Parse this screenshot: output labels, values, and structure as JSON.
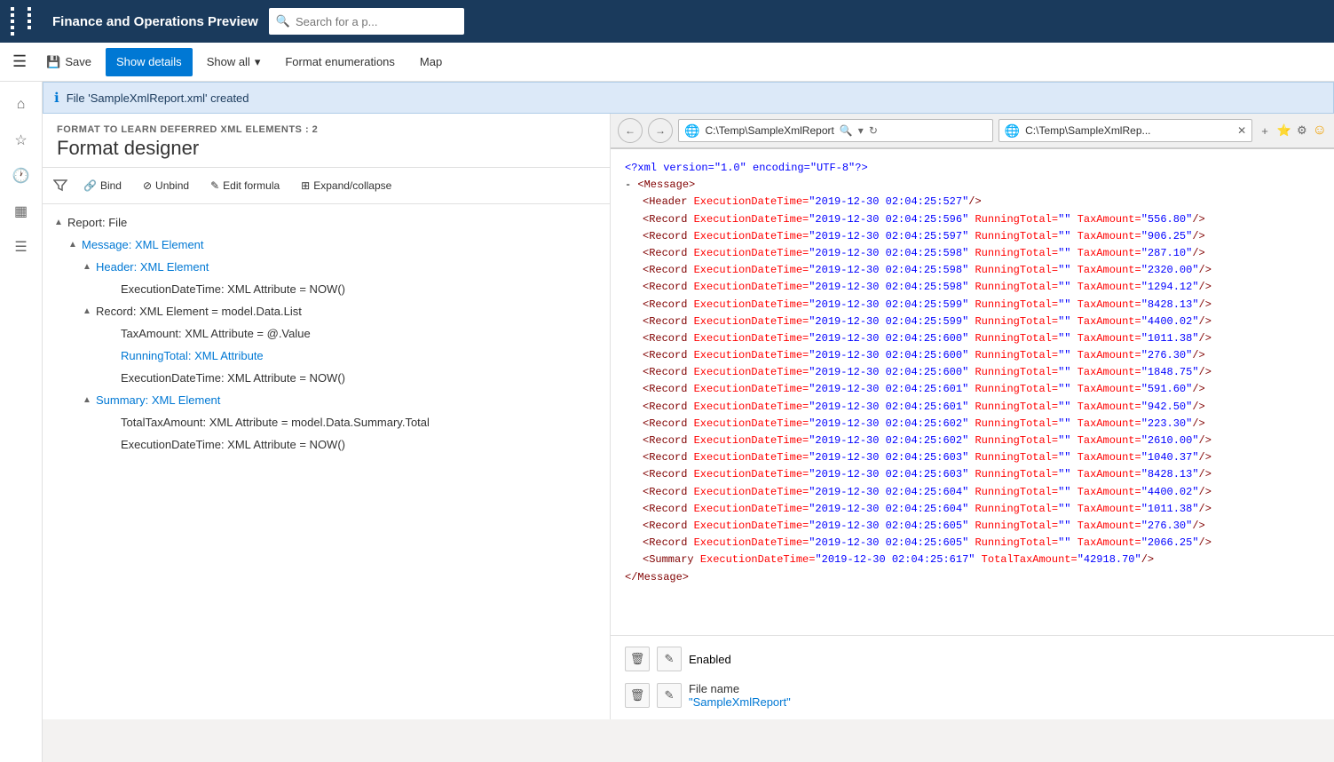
{
  "app": {
    "title": "Finance and Operations Preview",
    "search_placeholder": "Search for a p..."
  },
  "action_bar": {
    "save_label": "Save",
    "show_details_label": "Show details",
    "show_all_label": "Show all",
    "format_enumerations_label": "Format enumerations",
    "map_label": "Map"
  },
  "notification": {
    "text": "File 'SampleXmlReport.xml' created"
  },
  "panel": {
    "subtitle": "FORMAT TO LEARN DEFERRED XML ELEMENTS : 2",
    "title": "Format designer",
    "bind_label": "Bind",
    "unbind_label": "Unbind",
    "edit_formula_label": "Edit formula",
    "expand_collapse_label": "Expand/collapse"
  },
  "tree": {
    "items": [
      {
        "indent": 0,
        "arrow": "▲",
        "label": "Report: File",
        "type": "normal"
      },
      {
        "indent": 1,
        "arrow": "▲",
        "label": "Message: XML Element",
        "type": "blue"
      },
      {
        "indent": 2,
        "arrow": "▲",
        "label": "Header: XML Element",
        "type": "blue"
      },
      {
        "indent": 3,
        "arrow": "",
        "label": "ExecutionDateTime: XML Attribute = NOW()",
        "type": "normal"
      },
      {
        "indent": 2,
        "arrow": "▲",
        "label": "Record: XML Element = model.Data.List",
        "type": "normal"
      },
      {
        "indent": 3,
        "arrow": "",
        "label": "TaxAmount: XML Attribute = @.Value",
        "type": "normal"
      },
      {
        "indent": 3,
        "arrow": "",
        "label": "RunningTotal: XML Attribute",
        "type": "blue"
      },
      {
        "indent": 3,
        "arrow": "",
        "label": "ExecutionDateTime: XML Attribute = NOW()",
        "type": "normal"
      },
      {
        "indent": 2,
        "arrow": "▲",
        "label": "Summary: XML Element",
        "type": "blue"
      },
      {
        "indent": 3,
        "arrow": "",
        "label": "TotalTaxAmount: XML Attribute = model.Data.Summary.Total",
        "type": "normal"
      },
      {
        "indent": 3,
        "arrow": "",
        "label": "ExecutionDateTime: XML Attribute = NOW()",
        "type": "normal"
      }
    ]
  },
  "browser": {
    "address1": "C:\\Temp\\SampleXmlReport",
    "address2": "C:\\Temp\\SampleXmlRep...",
    "tab1_label": "C:\\Temp\\SampleXmlReport",
    "tab2_label": "C:\\Temp\\SampleXmlRep..."
  },
  "xml": {
    "declaration": "<?xml version=\"1.0\" encoding=\"UTF-8\"?>",
    "records": [
      {
        "dt": "2019-12-30 02:04:25:527",
        "rt": "",
        "tax": ""
      },
      {
        "dt": "2019-12-30 02:04:25:596",
        "rt": "",
        "tax": "556.80"
      },
      {
        "dt": "2019-12-30 02:04:25:597",
        "rt": "",
        "tax": "906.25"
      },
      {
        "dt": "2019-12-30 02:04:25:598",
        "rt": "",
        "tax": "287.10"
      },
      {
        "dt": "2019-12-30 02:04:25:598",
        "rt": "",
        "tax": "2320.00"
      },
      {
        "dt": "2019-12-30 02:04:25:598",
        "rt": "",
        "tax": "1294.12"
      },
      {
        "dt": "2019-12-30 02:04:25:599",
        "rt": "",
        "tax": "8428.13"
      },
      {
        "dt": "2019-12-30 02:04:25:599",
        "rt": "",
        "tax": "4400.02"
      },
      {
        "dt": "2019-12-30 02:04:25:600",
        "rt": "",
        "tax": "1011.38"
      },
      {
        "dt": "2019-12-30 02:04:25:600",
        "rt": "",
        "tax": "276.30"
      },
      {
        "dt": "2019-12-30 02:04:25:600",
        "rt": "",
        "tax": "1848.75"
      },
      {
        "dt": "2019-12-30 02:04:25:601",
        "rt": "",
        "tax": "591.60"
      },
      {
        "dt": "2019-12-30 02:04:25:601",
        "rt": "",
        "tax": "942.50"
      },
      {
        "dt": "2019-12-30 02:04:25:602",
        "rt": "",
        "tax": "223.30"
      },
      {
        "dt": "2019-12-30 02:04:25:602",
        "rt": "",
        "tax": "2610.00"
      },
      {
        "dt": "2019-12-30 02:04:25:603",
        "rt": "",
        "tax": "1040.37"
      },
      {
        "dt": "2019-12-30 02:04:25:603",
        "rt": "",
        "tax": "8428.13"
      },
      {
        "dt": "2019-12-30 02:04:25:604",
        "rt": "",
        "tax": "4400.02"
      },
      {
        "dt": "2019-12-30 02:04:25:604",
        "rt": "",
        "tax": "1011.38"
      },
      {
        "dt": "2019-12-30 02:04:25:605",
        "rt": "",
        "tax": "276.30"
      },
      {
        "dt": "2019-12-30 02:04:25:605",
        "rt": "",
        "tax": "2066.25"
      }
    ],
    "summary_dt": "2019-12-30 02:04:25:617",
    "summary_total": "42918.70"
  },
  "properties": {
    "enabled_label": "Enabled",
    "filename_label": "File name",
    "filename_value": "\"SampleXmlReport\""
  },
  "icons": {
    "grid": "⊞",
    "save": "💾",
    "chevron_down": "▾",
    "hamburger": "☰",
    "home": "⌂",
    "star": "☆",
    "clock": "🕐",
    "table": "▦",
    "list": "☰",
    "filter": "⊿",
    "link": "🔗",
    "unlink": "⊘",
    "formula": "✎",
    "expand": "⊞",
    "delete": "🗑",
    "edit": "✎",
    "back": "←",
    "forward": "→",
    "refresh": "↻",
    "search": "🔍",
    "close": "✕",
    "new_tab": "+"
  }
}
